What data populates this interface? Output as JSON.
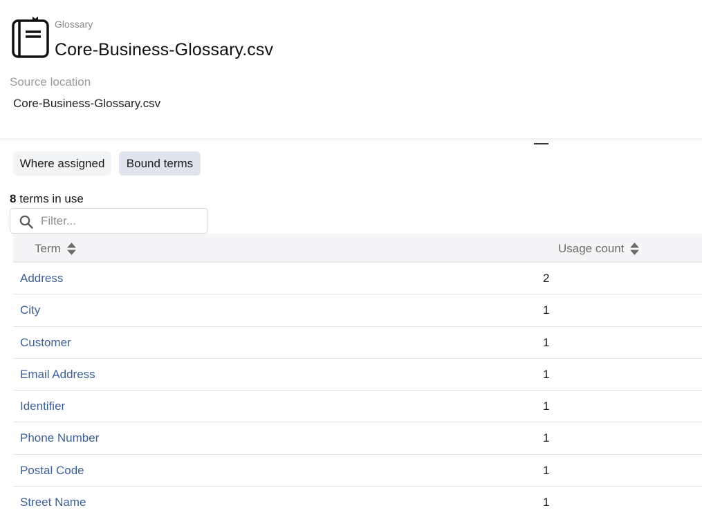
{
  "header": {
    "type_label": "Glossary",
    "title": "Core-Business-Glossary.csv",
    "source_label": "Source location",
    "source_value": "Core-Business-Glossary.csv"
  },
  "tabs": [
    {
      "label": "Where assigned",
      "active": false
    },
    {
      "label": "Bound terms",
      "active": true
    }
  ],
  "summary": {
    "count": "8",
    "suffix": " terms in use"
  },
  "filter": {
    "placeholder": "Filter...",
    "value": ""
  },
  "table": {
    "columns": [
      "Term",
      "Usage count"
    ],
    "rows": [
      {
        "term": "Address",
        "usage": "2"
      },
      {
        "term": "City",
        "usage": "1"
      },
      {
        "term": "Customer",
        "usage": "1"
      },
      {
        "term": "Email Address",
        "usage": "1"
      },
      {
        "term": "Identifier",
        "usage": "1"
      },
      {
        "term": "Phone Number",
        "usage": "1"
      },
      {
        "term": "Postal Code",
        "usage": "1"
      },
      {
        "term": "Street Name",
        "usage": "1"
      }
    ]
  },
  "icons": {
    "glossary": "book-icon",
    "search": "search-icon",
    "sort": "sort-icon"
  },
  "colors": {
    "link": "#3c5f96",
    "active_tab": "#dfe4ee",
    "inactive_tab": "#f3f4f6",
    "table_header": "#f5f5f7"
  }
}
